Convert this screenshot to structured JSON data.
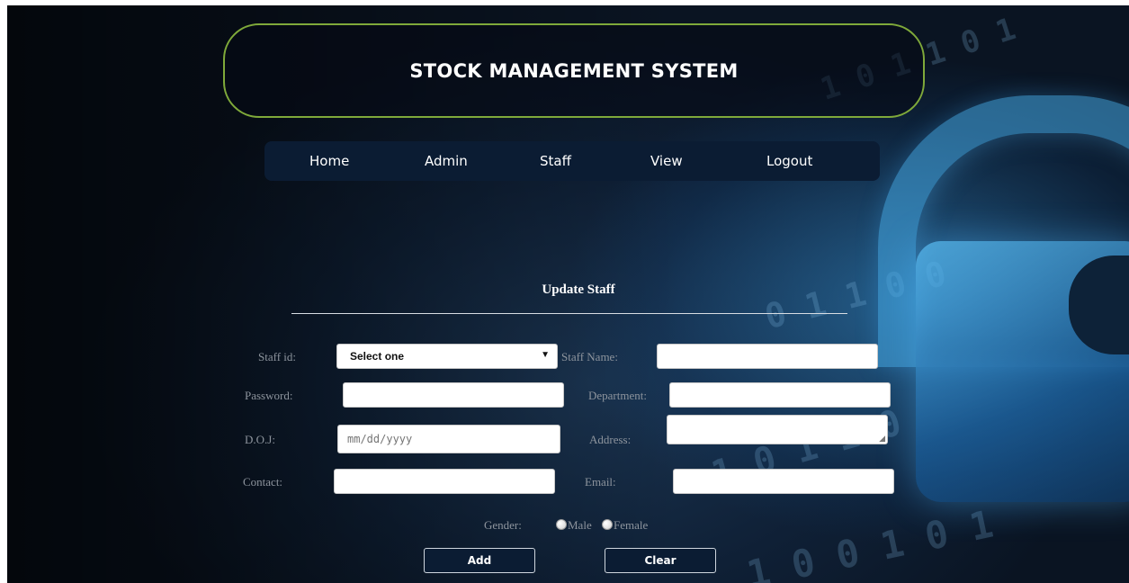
{
  "header": {
    "title": "STOCK MANAGEMENT SYSTEM"
  },
  "nav": {
    "items": [
      {
        "label": "Home"
      },
      {
        "label": "Admin"
      },
      {
        "label": "Staff"
      },
      {
        "label": "View"
      },
      {
        "label": "Logout"
      }
    ]
  },
  "form": {
    "title": "Update Staff",
    "staff_id": {
      "label": "Staff id:",
      "selected": "Select one"
    },
    "staff_name": {
      "label": "Staff Name:",
      "value": ""
    },
    "password": {
      "label": "Password:",
      "value": ""
    },
    "department": {
      "label": "Department:",
      "value": ""
    },
    "doj": {
      "label": "D.O.J:",
      "placeholder": "mm/dd/yyyy"
    },
    "address": {
      "label": "Address:",
      "value": ""
    },
    "contact": {
      "label": "Contact:",
      "value": ""
    },
    "email": {
      "label": "Email:",
      "value": ""
    },
    "gender": {
      "label": "Gender:",
      "options": [
        "Male",
        "Female"
      ]
    },
    "buttons": {
      "add": "Add",
      "clear": "Clear"
    }
  },
  "colors": {
    "header_border": "#7fa93a",
    "nav_bg": "#0b1c33",
    "label_text": "#8d949d"
  }
}
